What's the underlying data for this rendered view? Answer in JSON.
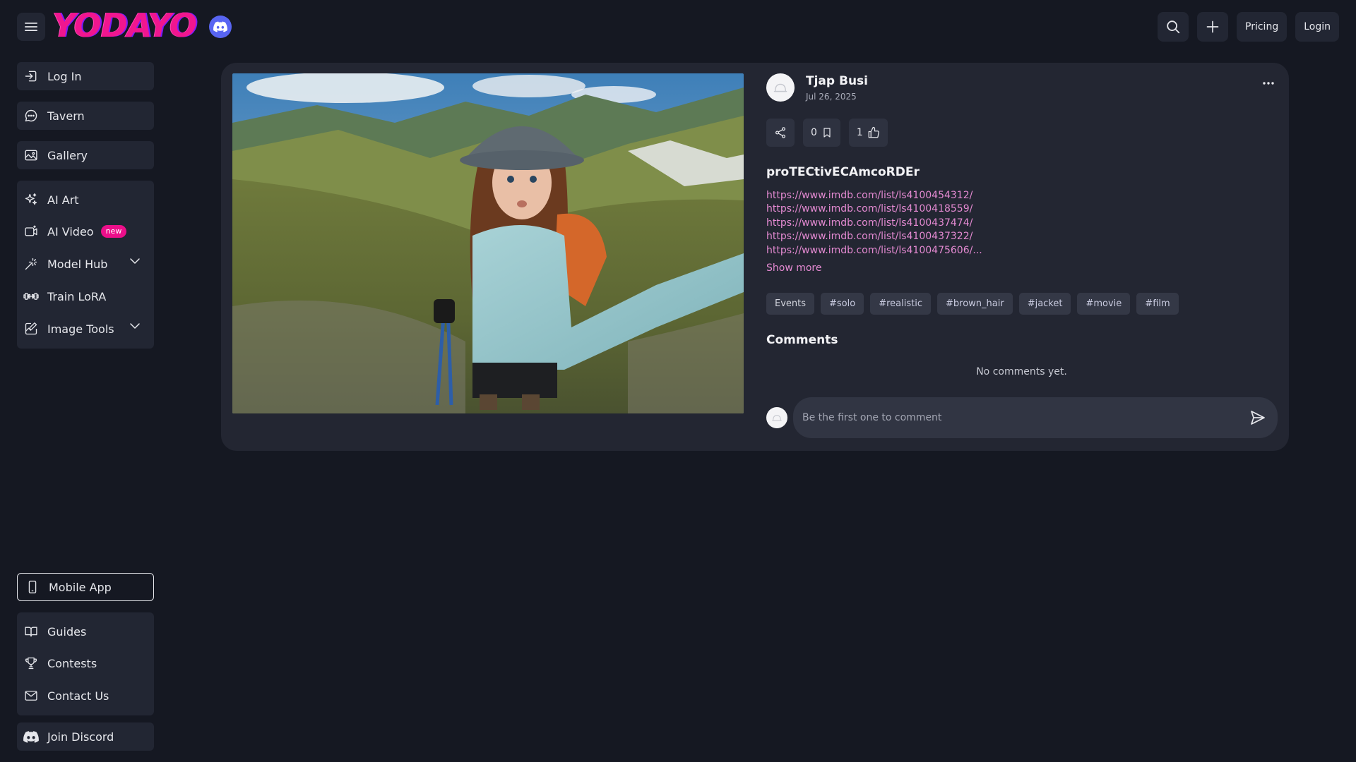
{
  "header": {
    "logo_text": "YODAYO",
    "pricing_label": "Pricing",
    "login_label": "Login"
  },
  "sidebar": {
    "group1": [
      {
        "label": "Log In",
        "icon": "login-icon"
      }
    ],
    "group2": [
      {
        "label": "Tavern",
        "icon": "chat-bubble-icon"
      }
    ],
    "group3": [
      {
        "label": "Gallery",
        "icon": "image-icon"
      }
    ],
    "group4": [
      {
        "label": "AI Art",
        "icon": "sparkles-icon"
      },
      {
        "label": "AI Video",
        "icon": "video-icon",
        "badge": "new"
      },
      {
        "label": "Model Hub",
        "icon": "magic-wand-icon",
        "expandable": true
      },
      {
        "label": "Train LoRA",
        "icon": "dumbbell-icon"
      },
      {
        "label": "Image Tools",
        "icon": "image-edit-icon",
        "expandable": true
      }
    ],
    "mobile_app": {
      "label": "Mobile App",
      "icon": "phone-icon"
    },
    "group5": [
      {
        "label": "Guides",
        "icon": "book-icon"
      },
      {
        "label": "Contests",
        "icon": "trophy-icon"
      },
      {
        "label": "Contact Us",
        "icon": "mail-icon"
      }
    ],
    "group6": [
      {
        "label": "Join Discord",
        "icon": "discord-icon"
      }
    ]
  },
  "post": {
    "author": "Tjap Busi",
    "date": "Jul 26, 2025",
    "bookmark_count": "0",
    "like_count": "1",
    "title": "proTECtivECAmcoRDEr",
    "links": [
      "https://www.imdb.com/list/ls4100454312/",
      "https://www.imdb.com/list/ls4100418559/",
      "https://www.imdb.com/list/ls4100437474/",
      "https://www.imdb.com/list/ls4100437322/",
      "https://www.imdb.com/list/ls4100475606/..."
    ],
    "show_more": "Show more",
    "tags": [
      "Events",
      "#solo",
      "#realistic",
      "#brown_hair",
      "#jacket",
      "#movie",
      "#film"
    ]
  },
  "comments": {
    "title": "Comments",
    "empty_text": "No comments yet.",
    "placeholder": "Be the first one to comment"
  }
}
